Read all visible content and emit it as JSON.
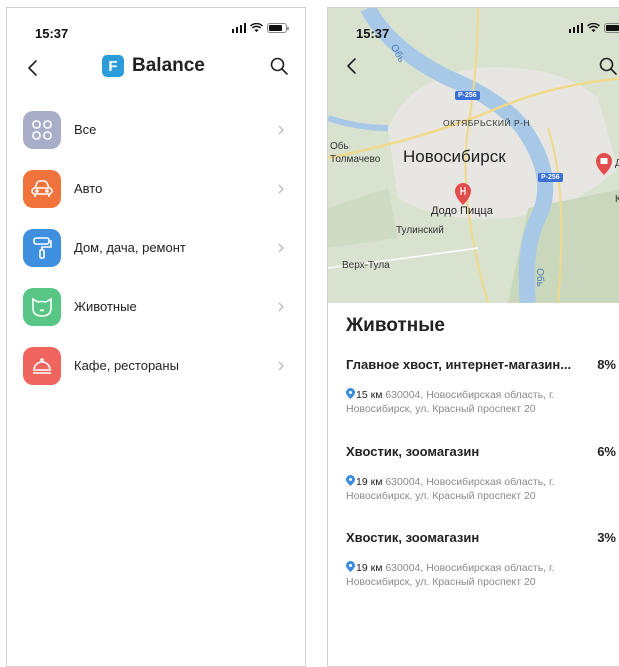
{
  "left": {
    "status": {
      "time": "15:37"
    },
    "header": {
      "logo_letter": "F",
      "brand": "Balance"
    },
    "categories": [
      {
        "label": "Все",
        "color": "#a8aec8",
        "icon": "grid-icon"
      },
      {
        "label": "Авто",
        "color": "#f0733c",
        "icon": "car-icon"
      },
      {
        "label": "Дом, дача, ремонт",
        "color": "#3f8fe0",
        "icon": "paint-roller-icon"
      },
      {
        "label": "Животные",
        "color": "#58c684",
        "icon": "cat-icon"
      },
      {
        "label": "Кафе, рестораны",
        "color": "#f0665e",
        "icon": "dish-cover-icon"
      }
    ]
  },
  "right": {
    "status": {
      "time": "15:37"
    },
    "map": {
      "labels": {
        "ob_top": "Обь",
        "ob_left": "Обь",
        "city": "Новосибирск",
        "district": "ОКТЯБРЬСКИЙ Р-Н",
        "tolmachevo": "Толмачево",
        "dodo": "Додо Пицца",
        "tulinsky": "Тулинский",
        "verh_tula": "Верх-Тула",
        "ob_river": "Обь",
        "road1": "P-256",
        "road2": "P-256",
        "partial_right": "Ко",
        "partial_right2": "Д"
      }
    },
    "section_title": "Животные",
    "shops": [
      {
        "name": "Главное хвост, интернет-магазин...",
        "percent": "8%",
        "distance": "15 км",
        "address": "630004, Новосибирская область, г. Новосибирск, ул. Красный проспект 20"
      },
      {
        "name": "Хвостик, зоомагазин",
        "percent": "6%",
        "distance": "19 км",
        "address": "630004, Новосибирская область, г. Новосибирск, ул. Красный проспект 20"
      },
      {
        "name": "Хвостик, зоомагазин",
        "percent": "3%",
        "distance": "19 км",
        "address": "630004, Новосибирская область, г. Новосибирск, ул. Красный проспект 20"
      }
    ]
  }
}
